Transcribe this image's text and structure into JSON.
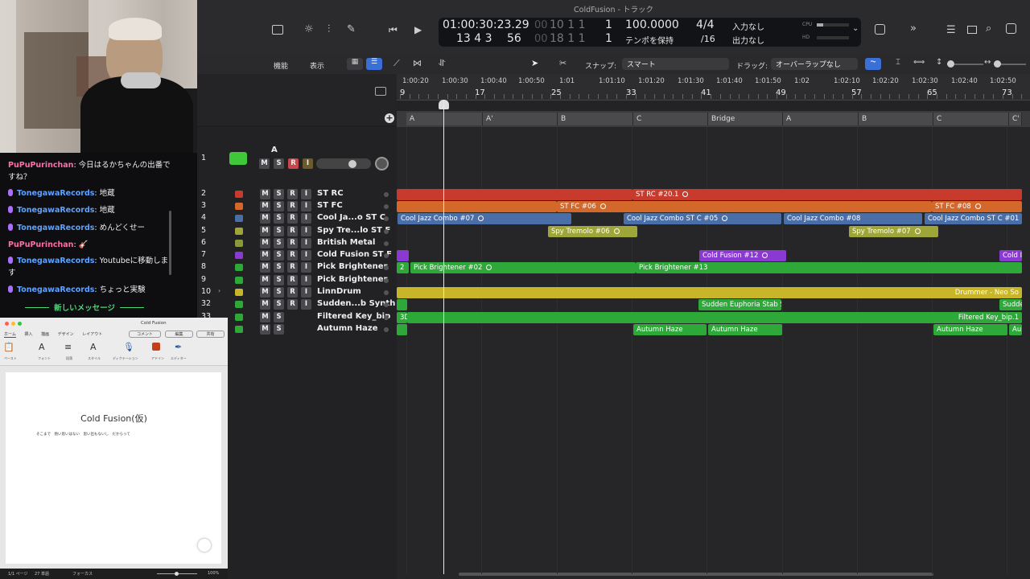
{
  "window": {
    "title": "ColdFusion - トラック"
  },
  "lcd": {
    "time": "01:00:30:23.29",
    "time_dim": "00",
    "bars": "10  1  1",
    "bars_dim": "00",
    "subframe": "1",
    "pos1": "13  4  3",
    "pos2": "56",
    "pos_dim": "00",
    "pos3": "18  1  1",
    "pos4": "1",
    "tempo": "100.0000",
    "tempo_mode": "テンポを保持",
    "sig": "4/4",
    "div": "/16",
    "in": "入力なし",
    "out": "出力なし",
    "cpu": "CPU",
    "hd": "HD"
  },
  "toolbar": {
    "functions": "機能",
    "view": "表示",
    "snap_label": "スナップ:",
    "snap_value": "スマート",
    "drag_label": "ドラッグ:",
    "drag_value": "オーバーラップなし"
  },
  "ruler": {
    "times": [
      "1:00:20",
      "1:00:30",
      "1:00:40",
      "1:00:50",
      "1:01",
      "1:01:10",
      "1:01:20",
      "1:01:30",
      "1:01:40",
      "1:01:50",
      "1:02",
      "1:02:10",
      "1:02:20",
      "1:02:30",
      "1:02:40",
      "1:02:50"
    ],
    "bars": [
      "9",
      "17",
      "25",
      "33",
      "41",
      "49",
      "57",
      "65",
      "73"
    ]
  },
  "markers": [
    "A",
    "A'",
    "B",
    "C",
    "Bridge",
    "A",
    "B",
    "C",
    "C'"
  ],
  "tracks": [
    {
      "num": "1",
      "name": "A",
      "buttons": [
        "M",
        "S",
        "R",
        "I"
      ]
    },
    {
      "num": "2",
      "name": "ST RC",
      "color": "#c83a2c"
    },
    {
      "num": "3",
      "name": "ST FC",
      "color": "#d4682a"
    },
    {
      "num": "4",
      "name": "Cool Ja...o ST C",
      "color": "#4a6fa8"
    },
    {
      "num": "5",
      "name": "Spy Tre...lo ST F",
      "color": "#9ea63a"
    },
    {
      "num": "6",
      "name": "British Metal",
      "color": "#8a9a3a"
    },
    {
      "num": "7",
      "name": "Cold Fusion ST F",
      "color": "#8a3ad0"
    },
    {
      "num": "8",
      "name": "Pick Brightener",
      "color": "#2fa83a"
    },
    {
      "num": "9",
      "name": "Pick Brightener",
      "color": "#2fa83a"
    },
    {
      "num": "10",
      "name": "LinnDrum",
      "color": "#c8b52a"
    },
    {
      "num": "32",
      "name": "Sudden...b Synth",
      "color": "#2fa83a"
    },
    {
      "num": "33",
      "name": "Filtered Key_bip",
      "color": "#2fa83a"
    },
    {
      "num": "34",
      "name": "Autumn Haze",
      "color": "#2fa83a"
    }
  ],
  "regions": {
    "r2": [
      "ST RC #20.1"
    ],
    "r3": [
      "ST FC #06",
      "ST FC #08"
    ],
    "r4": [
      "Cool Jazz Combo #07",
      "Cool Jazz Combo ST C #05",
      "Cool Jazz Combo #08",
      "Cool Jazz Combo ST C #01"
    ],
    "r5": [
      "Spy Tremolo #06",
      "Spy Tremolo #07"
    ],
    "r7": [
      "Cold Fusion #12",
      "Cold I"
    ],
    "r8": [
      "2",
      "Pick Brightener #02",
      "Pick Brightener #13"
    ],
    "r10": [
      "Drummer - Neo So"
    ],
    "r32": [
      "Sudden Euphoria Stab S",
      "Sudde"
    ],
    "r33": [
      "3D",
      "Filtered Key_bip.1"
    ],
    "r34": [
      "Autumn Haze",
      "Autumn Haze",
      "Autumn Haze",
      "Au"
    ]
  },
  "chat": {
    "messages": [
      {
        "user": "PuPuPurinchan",
        "text": ": 今日はるかちゃんの出番で",
        "text2": "すね？",
        "mic": false,
        "color": "#ff6ea8"
      },
      {
        "user": "TonegawaRecords",
        "text": ": 地蔵",
        "mic": true,
        "color": "#5ea1ff"
      },
      {
        "user": "TonegawaRecords",
        "text": ": 地蔵",
        "mic": true,
        "color": "#5ea1ff"
      },
      {
        "user": "TonegawaRecords",
        "text": ": めんどくせー",
        "mic": true,
        "color": "#5ea1ff"
      },
      {
        "user": "PuPuPurinchan",
        "text": ": 🎸",
        "mic": false,
        "color": "#ff6ea8"
      },
      {
        "user": "TonegawaRecords",
        "text": ": Youtubeに移動しま",
        "text2": "す",
        "mic": true,
        "color": "#5ea1ff"
      },
      {
        "user": "TonegawaRecords",
        "text": ": ちょっと実験",
        "mic": true,
        "color": "#5ea1ff"
      }
    ],
    "new_messages": "新しいメッセージ"
  },
  "word": {
    "title": "Cold Fusion",
    "tabs": [
      "ホーム",
      "挿入",
      "描画",
      "デザイン",
      "レイアウト"
    ],
    "comment": "コメント",
    "edit": "編集",
    "share": "共有",
    "groups": [
      "ペースト",
      "フォント",
      "段落",
      "スタイル",
      "ディクテーション",
      "アドイン",
      "エディター"
    ],
    "doc_title": "Cold Fusion(仮)",
    "doc_body": "そこまで　熱い思いはない　思い出もないし　だからって",
    "status_page": "1/1 ページ",
    "status_words": "27 単語",
    "status_focus": "フォーカス",
    "zoom": "100%"
  }
}
